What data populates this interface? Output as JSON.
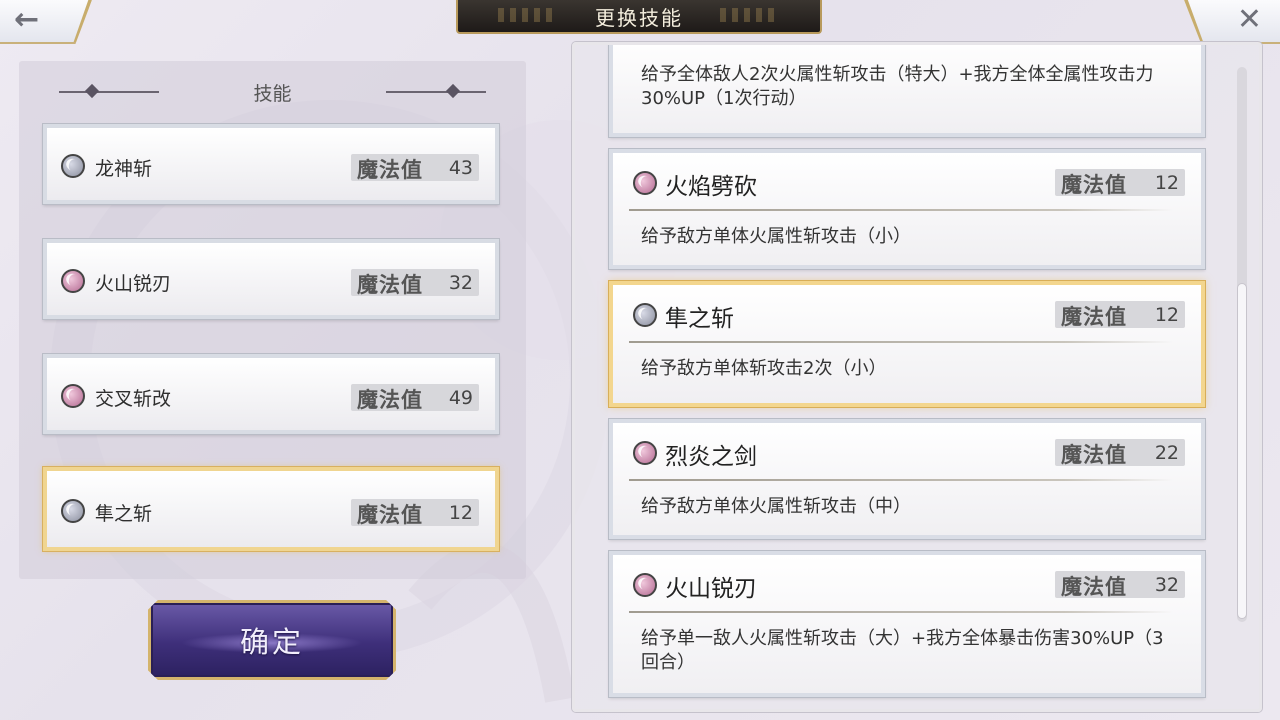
{
  "header": {
    "title": "更换技能",
    "back_icon": "arrow-left-icon",
    "close_icon": "close-icon"
  },
  "left_panel": {
    "heading": "技能",
    "mp_label": "魔法值",
    "slots": [
      {
        "name": "龙神斩",
        "mp": "43",
        "orb": "gray",
        "selected": false
      },
      {
        "name": "火山锐刃",
        "mp": "32",
        "orb": "pink",
        "selected": false
      },
      {
        "name": "交叉斩改",
        "mp": "49",
        "orb": "pink",
        "selected": false
      },
      {
        "name": "隼之斩",
        "mp": "12",
        "orb": "gray",
        "selected": true
      }
    ],
    "confirm_label": "确定"
  },
  "right_panel": {
    "mp_label": "魔法值",
    "cards": [
      {
        "name": "",
        "mp": "",
        "desc": "给予全体敌人2次火属性斩攻击（特大）+我方全体全属性攻击力30%UP（1次行动）",
        "partial": true
      },
      {
        "name": "火焰劈砍",
        "mp": "12",
        "orb": "pink",
        "desc": "给予敌方单体火属性斩攻击（小）"
      },
      {
        "name": "隼之斩",
        "mp": "12",
        "orb": "gray",
        "desc": "给予敌方单体斩攻击2次（小）",
        "selected": true
      },
      {
        "name": "烈炎之剑",
        "mp": "22",
        "orb": "pink",
        "desc": "给予敌方单体火属性斩攻击（中）"
      },
      {
        "name": "火山锐刃",
        "mp": "32",
        "orb": "pink",
        "desc": "给予单一敌人火属性斩攻击（大）+我方全体暴击伤害30%UP（3回合）"
      }
    ]
  },
  "colors": {
    "accent_gold": "#d4b46c",
    "confirm_purple": "#3e2f7a",
    "orb_pink": "#b46a92",
    "orb_gray": "#8a8e9e"
  }
}
